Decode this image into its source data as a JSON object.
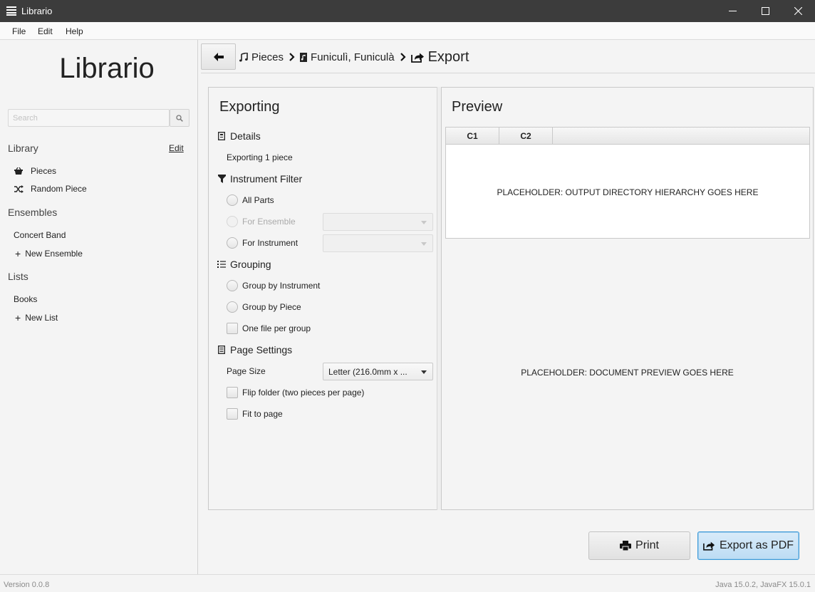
{
  "window": {
    "title": "Librario",
    "controls": {
      "minimize": "minimize-icon",
      "maximize": "maximize-icon",
      "close": "close-icon"
    }
  },
  "menu": [
    "File",
    "Edit",
    "Help"
  ],
  "sidebar": {
    "logo": "Librario",
    "search": {
      "placeholder": "Search",
      "value": "",
      "icon": "search-icon"
    },
    "library": {
      "title": "Library",
      "edit_label": "Edit",
      "items": [
        {
          "label": "Pieces",
          "icon": "basket-icon"
        },
        {
          "label": "Random Piece",
          "icon": "shuffle-icon"
        }
      ]
    },
    "ensembles": {
      "title": "Ensembles",
      "items": [
        {
          "label": "Concert Band"
        }
      ],
      "new_label": "New Ensemble"
    },
    "lists": {
      "title": "Lists",
      "items": [
        {
          "label": "Books"
        }
      ],
      "new_label": "New List"
    }
  },
  "breadcrumb": {
    "back_icon": "arrow-left-icon",
    "items": [
      {
        "label": "Pieces",
        "icon": "music-note-icon"
      },
      {
        "label": "Funiculì, Funiculà",
        "icon": "music-file-icon"
      },
      {
        "label": "Export",
        "icon": "share-icon"
      }
    ]
  },
  "exporting": {
    "title": "Exporting",
    "details": {
      "heading": "Details",
      "text": "Exporting 1 piece"
    },
    "instrument_filter": {
      "heading": "Instrument Filter",
      "options": [
        {
          "label": "All Parts",
          "enabled": true
        },
        {
          "label": "For Ensemble",
          "enabled": false
        },
        {
          "label": "For Instrument",
          "enabled": true
        }
      ],
      "ensemble_select": "",
      "instrument_select": ""
    },
    "grouping": {
      "heading": "Grouping",
      "options": [
        "Group by Instrument",
        "Group by Piece"
      ],
      "one_file_label": "One file per group"
    },
    "page_settings": {
      "heading": "Page Settings",
      "page_size_label": "Page Size",
      "page_size_value": "Letter (216.0mm x ...",
      "flip_folder_label": "Flip folder (two pieces per page)",
      "fit_to_page_label": "Fit to page"
    }
  },
  "preview": {
    "title": "Preview",
    "columns": [
      "C1",
      "C2"
    ],
    "tree_placeholder": "PLACEHOLDER: OUTPUT DIRECTORY HIERARCHY GOES HERE",
    "doc_placeholder": "PLACEHOLDER: DOCUMENT PREVIEW GOES HERE"
  },
  "actions": {
    "print_label": "Print",
    "export_label": "Export as PDF"
  },
  "status": {
    "version": "Version 0.0.8",
    "runtime": "Java 15.0.2, JavaFX 15.0.1"
  }
}
